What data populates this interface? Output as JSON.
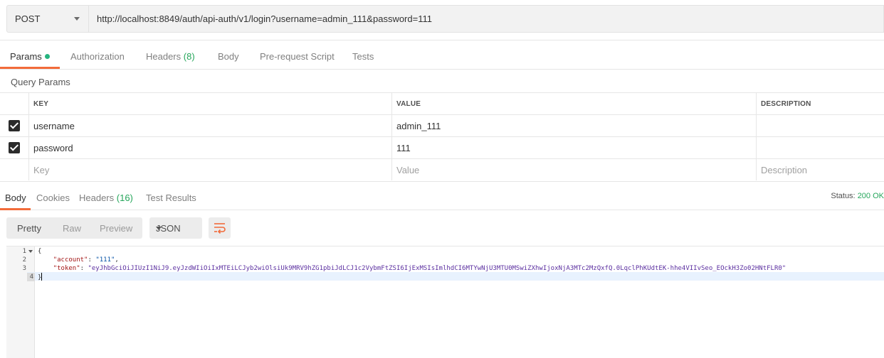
{
  "request": {
    "method": "POST",
    "url": "http://localhost:8849/auth/api-auth/v1/login?username=admin_111&password=111"
  },
  "request_tabs": [
    {
      "label": "Params",
      "active": true,
      "dot": true
    },
    {
      "label": "Authorization"
    },
    {
      "label": "Headers",
      "count": "(8)"
    },
    {
      "label": "Body"
    },
    {
      "label": "Pre-request Script"
    },
    {
      "label": "Tests"
    }
  ],
  "query_params": {
    "title": "Query Params",
    "headers": {
      "key": "KEY",
      "value": "VALUE",
      "description": "DESCRIPTION"
    },
    "rows": [
      {
        "checked": true,
        "key": "username",
        "value": "admin_111",
        "description": ""
      },
      {
        "checked": true,
        "key": "password",
        "value": "111",
        "description": ""
      }
    ],
    "placeholders": {
      "key": "Key",
      "value": "Value",
      "description": "Description"
    }
  },
  "response_tabs": [
    {
      "label": "Body",
      "active": true
    },
    {
      "label": "Cookies"
    },
    {
      "label": "Headers",
      "count": "(16)"
    },
    {
      "label": "Test Results"
    }
  ],
  "status": {
    "label": "Status:",
    "code": "200 OK"
  },
  "view_modes": [
    "Pretty",
    "Raw",
    "Preview"
  ],
  "active_view_mode": "Pretty",
  "format": "JSON",
  "wrap_icon": "wrap-lines-icon",
  "colors": {
    "accent": "#f26b3a",
    "success": "#26a65b"
  },
  "code": {
    "line_numbers": [
      "1",
      "2",
      "3",
      "4"
    ],
    "lines": [
      "{",
      "    \"account\": \"111\",",
      "    \"token\": \"eyJhbGciOiJIUzI1NiJ9.eyJzdWIiOiIxMTEiLCJyb2wiOlsiUk9MRV9hZG1pbiJdLCJ1c2VybmFtZSI6IjExMSIsImlhdCI6MTYwNjU3MTU0MSwiZXhwIjoxNjA3MTc2MzQxfQ.0LqclPhKUdtEK-hhe4VIIvSeo_EOckH3Zo02HNtFLR0\"",
      "}"
    ],
    "account_key": "\"account\"",
    "account_value": "\"111\"",
    "token_key": "\"token\"",
    "token_value": "\"eyJhbGciOiJIUzI1NiJ9.eyJzdWIiOiIxMTEiLCJyb2wiOlsiUk9MRV9hZG1pbiJdLCJ1c2VybmFtZSI6IjExMSIsImlhdCI6MTYwNjU3MTU0MSwiZXhwIjoxNjA3MTc2MzQxfQ.0LqclPhKUdtEK-hhe4VIIvSeo_EOckH3Zo02HNtFLR0\""
  }
}
